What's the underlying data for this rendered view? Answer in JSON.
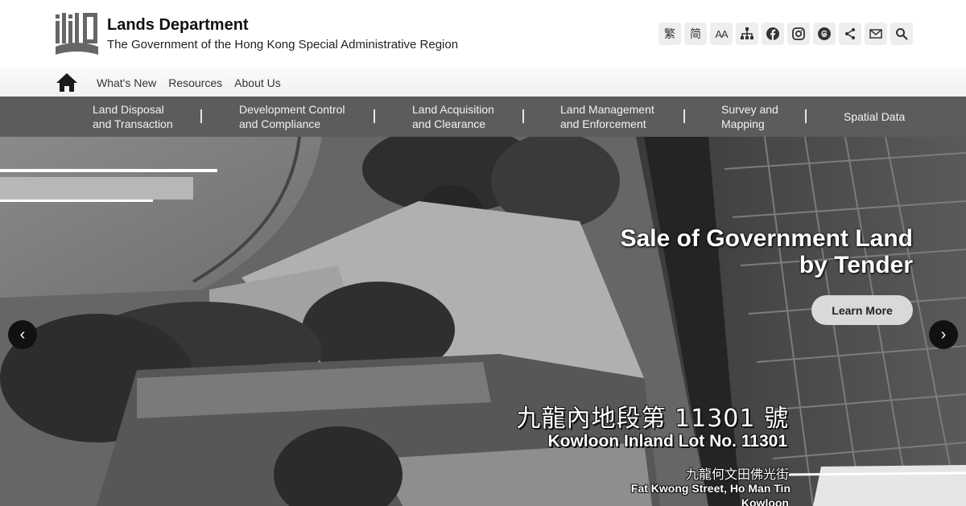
{
  "header": {
    "title": "Lands Department",
    "subtitle": "The Government of the Hong Kong Special Administrative Region",
    "logo_icon": "lands-department-logo"
  },
  "tools": [
    {
      "name": "traditional-chinese-button",
      "label": "繁",
      "icon": null
    },
    {
      "name": "simplified-chinese-button",
      "label": "简",
      "icon": null
    },
    {
      "name": "font-size-button",
      "label": "AA",
      "icon": null
    },
    {
      "name": "sitemap-button",
      "label": "",
      "icon": "sitemap-icon"
    },
    {
      "name": "facebook-button",
      "label": "",
      "icon": "facebook-icon"
    },
    {
      "name": "instagram-button",
      "label": "",
      "icon": "instagram-icon"
    },
    {
      "name": "threads-button",
      "label": "",
      "icon": "threads-icon"
    },
    {
      "name": "share-button",
      "label": "",
      "icon": "share-icon"
    },
    {
      "name": "email-button",
      "label": "",
      "icon": "mail-icon"
    },
    {
      "name": "search-button",
      "label": "",
      "icon": "search-icon"
    }
  ],
  "subnav": {
    "home_icon": "home-icon",
    "links": [
      "What's New",
      "Resources",
      "About Us"
    ]
  },
  "mainnav": {
    "items": [
      {
        "line1": "Land Disposal",
        "line2": "and Transaction"
      },
      {
        "line1": "Development Control",
        "line2": "and Compliance"
      },
      {
        "line1": "Land Acquisition",
        "line2": "and Clearance"
      },
      {
        "line1": "Land Management",
        "line2": "and Enforcement"
      },
      {
        "line1": "Survey and",
        "line2": "Mapping"
      },
      {
        "line1": "Spatial Data",
        "line2": ""
      }
    ]
  },
  "hero": {
    "title_line1": "Sale of Government Land",
    "title_line2": "by Tender",
    "cta_label": "Learn More",
    "prev_label": "‹",
    "next_label": "›",
    "lot_zh": "九龍內地段第 11301 號",
    "lot_en": "Kowloon Inland Lot No. 11301",
    "street_zh": "九龍何文田佛光街",
    "street_en": "Fat Kwong Street, Ho Man Tin",
    "district_en": "Kowloon"
  },
  "colors": {
    "mainnav_bg": "#5c5c5c",
    "arrow_bg": "#111111",
    "cta_bg": "#d9d9d9"
  }
}
